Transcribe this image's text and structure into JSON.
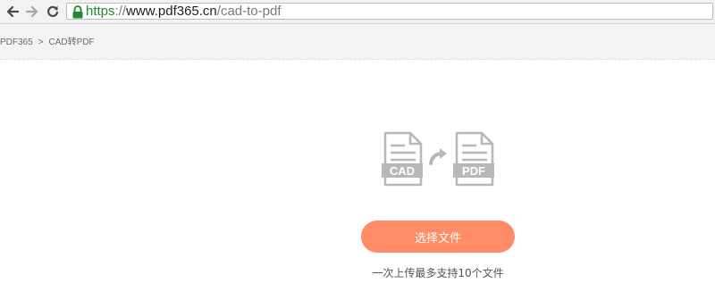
{
  "browser": {
    "url_scheme": "https",
    "url_separator": "://",
    "url_host": "www.pdf365.cn",
    "url_path": "/cad-to-pdf"
  },
  "breadcrumb": {
    "root": "PDF365",
    "separator": ">",
    "current": "CAD转PDF"
  },
  "main": {
    "illustration": {
      "source_label": "CAD",
      "target_label": "PDF"
    },
    "select_button_label": "选择文件",
    "upload_hint": "一次上传最多支持10个文件"
  },
  "colors": {
    "accent_button": "#ff8c66",
    "secure_green": "#1e8a2e",
    "icon_gray": "#b8b8b8"
  },
  "icons": {
    "back": "back-arrow-icon",
    "forward": "forward-arrow-icon",
    "reload": "reload-icon",
    "lock": "lock-icon",
    "cad_file": "cad-file-icon",
    "convert_arrow": "curved-arrow-icon",
    "pdf_file": "pdf-file-icon"
  }
}
